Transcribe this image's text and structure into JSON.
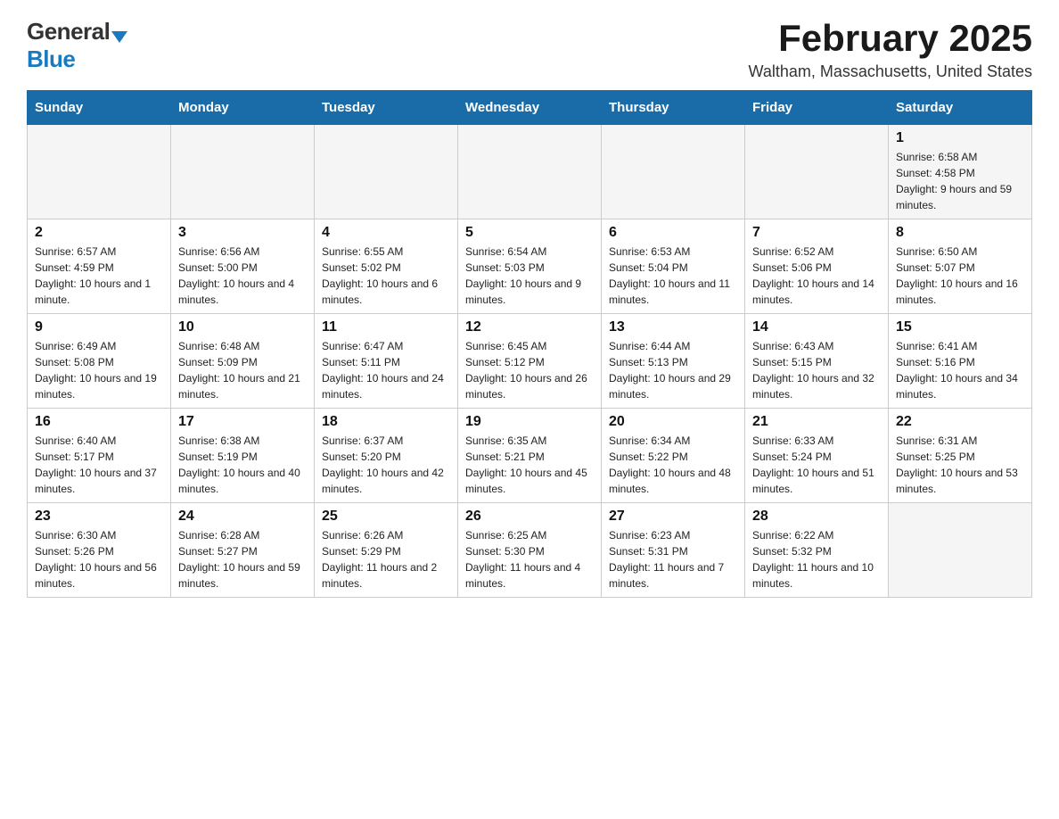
{
  "logo": {
    "general": "General",
    "blue": "Blue"
  },
  "header": {
    "title": "February 2025",
    "subtitle": "Waltham, Massachusetts, United States"
  },
  "weekdays": [
    "Sunday",
    "Monday",
    "Tuesday",
    "Wednesday",
    "Thursday",
    "Friday",
    "Saturday"
  ],
  "weeks": [
    [
      {
        "day": "",
        "info": ""
      },
      {
        "day": "",
        "info": ""
      },
      {
        "day": "",
        "info": ""
      },
      {
        "day": "",
        "info": ""
      },
      {
        "day": "",
        "info": ""
      },
      {
        "day": "",
        "info": ""
      },
      {
        "day": "1",
        "info": "Sunrise: 6:58 AM\nSunset: 4:58 PM\nDaylight: 9 hours and 59 minutes."
      }
    ],
    [
      {
        "day": "2",
        "info": "Sunrise: 6:57 AM\nSunset: 4:59 PM\nDaylight: 10 hours and 1 minute."
      },
      {
        "day": "3",
        "info": "Sunrise: 6:56 AM\nSunset: 5:00 PM\nDaylight: 10 hours and 4 minutes."
      },
      {
        "day": "4",
        "info": "Sunrise: 6:55 AM\nSunset: 5:02 PM\nDaylight: 10 hours and 6 minutes."
      },
      {
        "day": "5",
        "info": "Sunrise: 6:54 AM\nSunset: 5:03 PM\nDaylight: 10 hours and 9 minutes."
      },
      {
        "day": "6",
        "info": "Sunrise: 6:53 AM\nSunset: 5:04 PM\nDaylight: 10 hours and 11 minutes."
      },
      {
        "day": "7",
        "info": "Sunrise: 6:52 AM\nSunset: 5:06 PM\nDaylight: 10 hours and 14 minutes."
      },
      {
        "day": "8",
        "info": "Sunrise: 6:50 AM\nSunset: 5:07 PM\nDaylight: 10 hours and 16 minutes."
      }
    ],
    [
      {
        "day": "9",
        "info": "Sunrise: 6:49 AM\nSunset: 5:08 PM\nDaylight: 10 hours and 19 minutes."
      },
      {
        "day": "10",
        "info": "Sunrise: 6:48 AM\nSunset: 5:09 PM\nDaylight: 10 hours and 21 minutes."
      },
      {
        "day": "11",
        "info": "Sunrise: 6:47 AM\nSunset: 5:11 PM\nDaylight: 10 hours and 24 minutes."
      },
      {
        "day": "12",
        "info": "Sunrise: 6:45 AM\nSunset: 5:12 PM\nDaylight: 10 hours and 26 minutes."
      },
      {
        "day": "13",
        "info": "Sunrise: 6:44 AM\nSunset: 5:13 PM\nDaylight: 10 hours and 29 minutes."
      },
      {
        "day": "14",
        "info": "Sunrise: 6:43 AM\nSunset: 5:15 PM\nDaylight: 10 hours and 32 minutes."
      },
      {
        "day": "15",
        "info": "Sunrise: 6:41 AM\nSunset: 5:16 PM\nDaylight: 10 hours and 34 minutes."
      }
    ],
    [
      {
        "day": "16",
        "info": "Sunrise: 6:40 AM\nSunset: 5:17 PM\nDaylight: 10 hours and 37 minutes."
      },
      {
        "day": "17",
        "info": "Sunrise: 6:38 AM\nSunset: 5:19 PM\nDaylight: 10 hours and 40 minutes."
      },
      {
        "day": "18",
        "info": "Sunrise: 6:37 AM\nSunset: 5:20 PM\nDaylight: 10 hours and 42 minutes."
      },
      {
        "day": "19",
        "info": "Sunrise: 6:35 AM\nSunset: 5:21 PM\nDaylight: 10 hours and 45 minutes."
      },
      {
        "day": "20",
        "info": "Sunrise: 6:34 AM\nSunset: 5:22 PM\nDaylight: 10 hours and 48 minutes."
      },
      {
        "day": "21",
        "info": "Sunrise: 6:33 AM\nSunset: 5:24 PM\nDaylight: 10 hours and 51 minutes."
      },
      {
        "day": "22",
        "info": "Sunrise: 6:31 AM\nSunset: 5:25 PM\nDaylight: 10 hours and 53 minutes."
      }
    ],
    [
      {
        "day": "23",
        "info": "Sunrise: 6:30 AM\nSunset: 5:26 PM\nDaylight: 10 hours and 56 minutes."
      },
      {
        "day": "24",
        "info": "Sunrise: 6:28 AM\nSunset: 5:27 PM\nDaylight: 10 hours and 59 minutes."
      },
      {
        "day": "25",
        "info": "Sunrise: 6:26 AM\nSunset: 5:29 PM\nDaylight: 11 hours and 2 minutes."
      },
      {
        "day": "26",
        "info": "Sunrise: 6:25 AM\nSunset: 5:30 PM\nDaylight: 11 hours and 4 minutes."
      },
      {
        "day": "27",
        "info": "Sunrise: 6:23 AM\nSunset: 5:31 PM\nDaylight: 11 hours and 7 minutes."
      },
      {
        "day": "28",
        "info": "Sunrise: 6:22 AM\nSunset: 5:32 PM\nDaylight: 11 hours and 10 minutes."
      },
      {
        "day": "",
        "info": ""
      }
    ]
  ]
}
